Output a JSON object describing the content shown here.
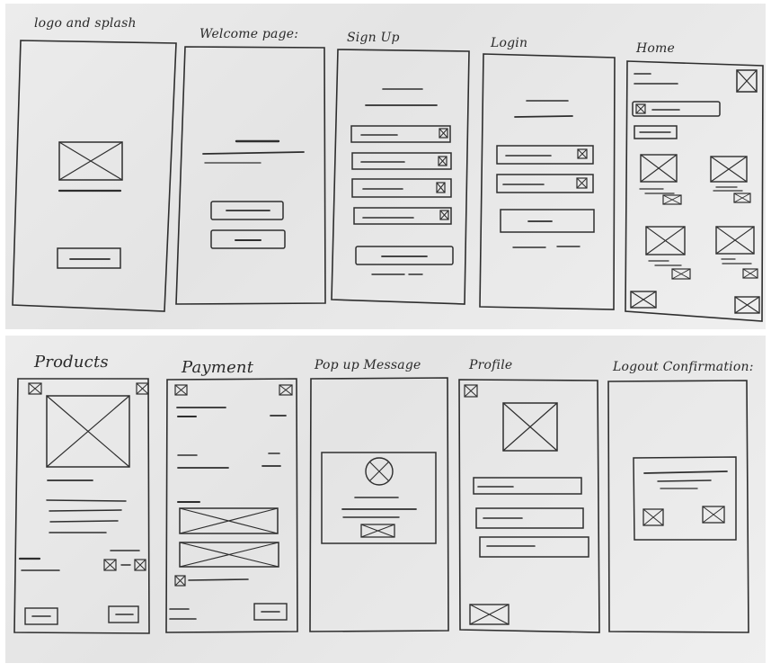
{
  "diagram": {
    "top_row": [
      {
        "id": "splash",
        "title": "logo and splash"
      },
      {
        "id": "welcome",
        "title": "Welcome page:"
      },
      {
        "id": "signup",
        "title": "Sign Up"
      },
      {
        "id": "login",
        "title": "Login"
      },
      {
        "id": "home",
        "title": "Home"
      }
    ],
    "bottom_row": [
      {
        "id": "products",
        "title": "Products"
      },
      {
        "id": "payment",
        "title": "Payment"
      },
      {
        "id": "popup",
        "title": "Pop up Message"
      },
      {
        "id": "profile",
        "title": "Profile"
      },
      {
        "id": "logout",
        "title": "Logout Confirmation:"
      }
    ]
  }
}
